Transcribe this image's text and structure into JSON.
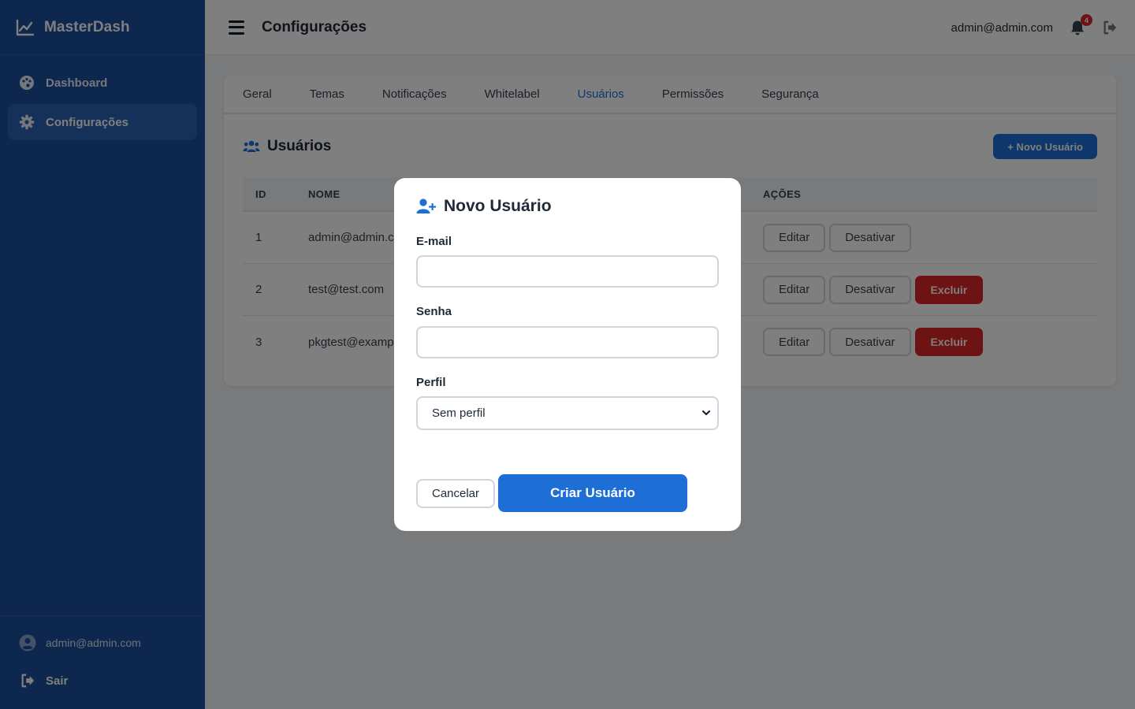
{
  "sidebar": {
    "brand": "MasterDash",
    "items": [
      {
        "label": "Dashboard",
        "icon": "palette-icon",
        "active": false
      },
      {
        "label": "Configurações",
        "icon": "gear-icon",
        "active": true
      }
    ],
    "footer": {
      "user_email": "admin@admin.com",
      "logout_label": "Sair"
    }
  },
  "header": {
    "title": "Configurações",
    "user_email": "admin@admin.com",
    "notification_count": "4"
  },
  "tabs": [
    {
      "label": "Geral",
      "active": false
    },
    {
      "label": "Temas",
      "active": false
    },
    {
      "label": "Notificações",
      "active": false
    },
    {
      "label": "Whitelabel",
      "active": false
    },
    {
      "label": "Usuários",
      "active": true
    },
    {
      "label": "Permissões",
      "active": false
    },
    {
      "label": "Segurança",
      "active": false
    }
  ],
  "users_section": {
    "title": "Usuários",
    "new_button": "+ Novo Usuário",
    "columns": {
      "id": "ID",
      "name": "NOME",
      "actions": "AÇÕES"
    },
    "rows": [
      {
        "id": "1",
        "name": "admin@admin.com",
        "edit": "Editar",
        "deactivate": "Desativar",
        "delete": null
      },
      {
        "id": "2",
        "name": "test@test.com",
        "edit": "Editar",
        "deactivate": "Desativar",
        "delete": "Excluir"
      },
      {
        "id": "3",
        "name": "pkgtest@example.com",
        "edit": "Editar",
        "deactivate": "Desativar",
        "delete": "Excluir"
      }
    ]
  },
  "modal": {
    "title": "Novo Usuário",
    "email_label": "E-mail",
    "email_value": "",
    "password_label": "Senha",
    "password_value": "",
    "profile_label": "Perfil",
    "profile_selected": "Sem perfil",
    "cancel_label": "Cancelar",
    "submit_label": "Criar Usuário"
  },
  "colors": {
    "sidebar_bg": "#1b4f9c",
    "primary": "#1d6fd6",
    "danger": "#dc2626"
  }
}
